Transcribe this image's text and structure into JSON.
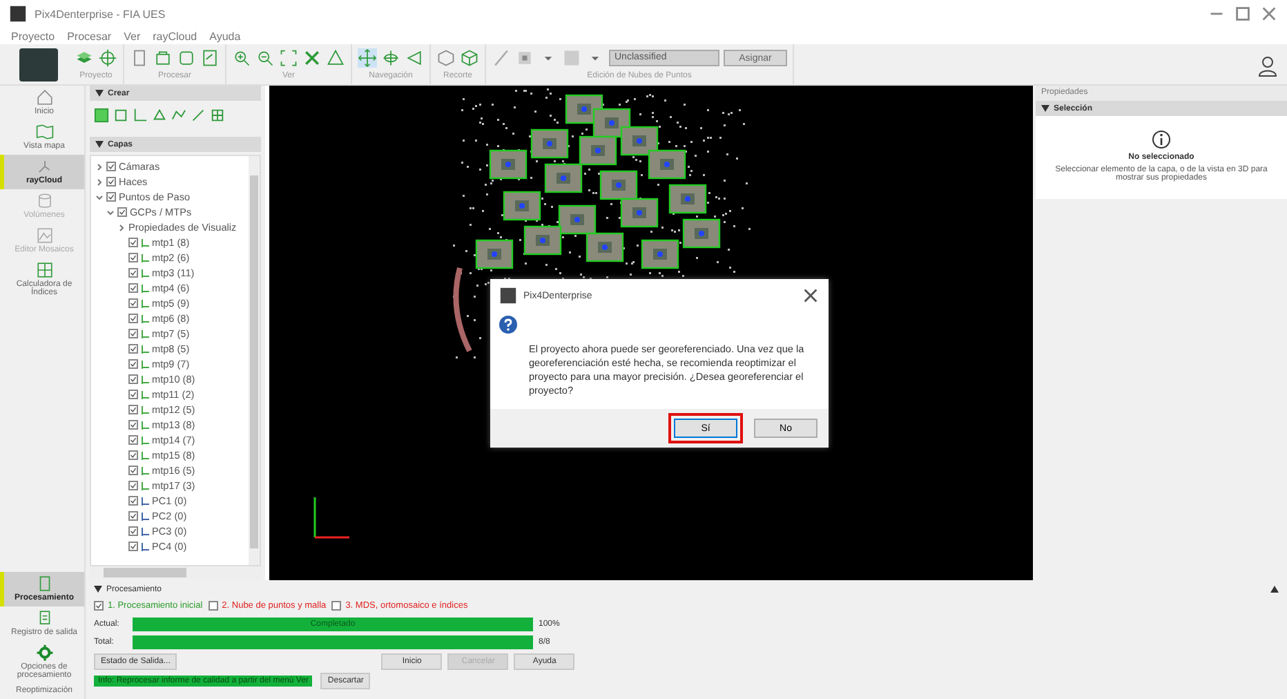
{
  "window": {
    "title": "Pix4Denterprise - FIA UES"
  },
  "menu": [
    "Proyecto",
    "Procesar",
    "Ver",
    "rayCloud",
    "Ayuda"
  ],
  "toolbar": {
    "groups": [
      {
        "label": "Proyecto"
      },
      {
        "label": "Procesar"
      },
      {
        "label": "Ver"
      },
      {
        "label": "Navegación"
      },
      {
        "label": "Recorte"
      },
      {
        "label": "Edición de Nubes de Puntos"
      }
    ],
    "class_dropdown": {
      "value": "Unclassified",
      "disabled": true
    },
    "assign_button": {
      "label": "Asignar",
      "disabled": true
    }
  },
  "nav": {
    "top": [
      {
        "label": "Inicio",
        "selected": false,
        "disabled": false
      },
      {
        "label": "Vista mapa",
        "selected": false,
        "disabled": false
      },
      {
        "label": "rayCloud",
        "selected": true,
        "disabled": false
      },
      {
        "label": "Volúmenes",
        "selected": false,
        "disabled": true
      },
      {
        "label": "Editor Mosaicos",
        "selected": false,
        "disabled": true
      },
      {
        "label": "Calculadora de Índices",
        "selected": false,
        "disabled": false
      }
    ],
    "bottom": [
      {
        "label": "Procesamiento",
        "selected": true,
        "disabled": false
      },
      {
        "label": "Registro de salida",
        "selected": false,
        "disabled": false
      },
      {
        "label": "Opciones de procesamiento",
        "selected": false,
        "disabled": false
      },
      {
        "label": "Reoptimización",
        "selected": false,
        "disabled": false
      }
    ]
  },
  "layers": {
    "create_title": "Crear",
    "layers_title": "Capas",
    "tree": [
      {
        "label": "Cámaras",
        "kind": "folder",
        "checked": true,
        "expanded": false
      },
      {
        "label": "Haces",
        "kind": "folder",
        "checked": true,
        "expanded": false
      },
      {
        "label": "Puntos de Paso",
        "kind": "folder",
        "checked": true,
        "expanded": true,
        "children": [
          {
            "label": "GCPs / MTPs",
            "kind": "folder",
            "checked": true,
            "expanded": true,
            "children": [
              {
                "label": "Propiedades de Visualiz",
                "kind": "settings",
                "expanded": false
              },
              {
                "label": "mtp1 (8)",
                "kind": "mtp",
                "checked": true
              },
              {
                "label": "mtp2 (6)",
                "kind": "mtp",
                "checked": true
              },
              {
                "label": "mtp3 (11)",
                "kind": "mtp",
                "checked": true
              },
              {
                "label": "mtp4 (6)",
                "kind": "mtp",
                "checked": true
              },
              {
                "label": "mtp5 (9)",
                "kind": "mtp",
                "checked": true
              },
              {
                "label": "mtp6 (8)",
                "kind": "mtp",
                "checked": true
              },
              {
                "label": "mtp7 (5)",
                "kind": "mtp",
                "checked": true
              },
              {
                "label": "mtp8 (5)",
                "kind": "mtp",
                "checked": true
              },
              {
                "label": "mtp9 (7)",
                "kind": "mtp",
                "checked": true
              },
              {
                "label": "mtp10 (8)",
                "kind": "mtp",
                "checked": true
              },
              {
                "label": "mtp11 (2)",
                "kind": "mtp",
                "checked": true
              },
              {
                "label": "mtp12 (5)",
                "kind": "mtp",
                "checked": true
              },
              {
                "label": "mtp13 (8)",
                "kind": "mtp",
                "checked": true
              },
              {
                "label": "mtp14 (7)",
                "kind": "mtp",
                "checked": true
              },
              {
                "label": "mtp15 (8)",
                "kind": "mtp",
                "checked": true
              },
              {
                "label": "mtp16 (5)",
                "kind": "mtp",
                "checked": true
              },
              {
                "label": "mtp17 (3)",
                "kind": "mtp",
                "checked": true
              },
              {
                "label": "PC1 (0)",
                "kind": "gcp",
                "checked": true
              },
              {
                "label": "PC2 (0)",
                "kind": "gcp",
                "checked": true
              },
              {
                "label": "PC3 (0)",
                "kind": "gcp",
                "checked": true
              },
              {
                "label": "PC4 (0)",
                "kind": "gcp",
                "checked": true
              }
            ]
          }
        ]
      }
    ]
  },
  "properties": {
    "title": "Propiedades",
    "section": "Selección",
    "heading": "No seleccionado",
    "text": "Seleccionar elemento de la capa, o de la vista en 3D para mostrar sus propiedades"
  },
  "dialog": {
    "title": "Pix4Denterprise",
    "message": "El proyecto ahora puede ser georeferenciado. Una vez que la georeferenciación esté hecha, se recomienda reoptimizar el proyecto para una mayor precisión. ¿Desea georeferenciar el proyecto?",
    "buttons": [
      {
        "label": "Sí",
        "focused": true,
        "highlighted": true
      },
      {
        "label": "No",
        "focused": false,
        "highlighted": false
      }
    ]
  },
  "processing": {
    "title": "Procesamiento",
    "steps": [
      {
        "label": "1. Procesamiento inicial",
        "checked": true,
        "done": true
      },
      {
        "label": "2. Nube de puntos y malla",
        "checked": false,
        "done": false
      },
      {
        "label": "3. MDS, ortomosaico e índices",
        "checked": false,
        "done": false
      }
    ],
    "bars": [
      {
        "label": "Actual:",
        "level": 1,
        "text": "Completado",
        "reading": "100%"
      },
      {
        "label": "Total:",
        "level": 1,
        "reading": "8/8"
      }
    ],
    "output_button": "Estado de Salida...",
    "buttons": [
      {
        "label": "Inicio",
        "disabled": false
      },
      {
        "label": "Cancelar",
        "disabled": true
      },
      {
        "label": "Ayuda",
        "disabled": false
      }
    ],
    "info": "Info: Reprocesar informe de calidad a partir del menú Ver",
    "discard": "Descartar"
  }
}
